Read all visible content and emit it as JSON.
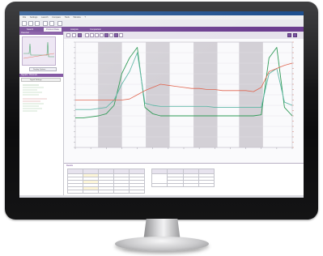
{
  "colors": {
    "bezel": "#111112",
    "title_bar": "#1e4f8e",
    "accent_purple": "#6b3d8f",
    "grey_band": "#d3d0d6",
    "green_trace": "#2f9a56",
    "teal_trace": "#5fb7a6",
    "red_trace": "#e0654f"
  },
  "window": {
    "title": ""
  },
  "menu": {
    "items": [
      "File",
      "Settings",
      "Launch",
      "Compare",
      "Tools",
      "Window",
      "?"
    ]
  },
  "tabs": [
    {
      "label": "Search"
    },
    {
      "label": "Protocol Data"
    },
    {
      "label": "Analysis"
    },
    {
      "label": "Comparison"
    }
  ],
  "left_panel": {
    "thumbnail_head": "Overview",
    "thumbnail_button": "Display Options",
    "tree_head": "Signals / Channels",
    "tree_toolbar_label": "Signal Settings"
  },
  "table": {
    "title": "Results",
    "headers": [
      "",
      "",
      "",
      "",
      "",
      ""
    ],
    "rows": 6
  },
  "chart_data": {
    "type": "line",
    "series": [
      {
        "values": [
          0.72,
          0.72,
          0.71,
          0.7,
          0.68,
          0.6,
          0.3,
          0.15,
          0.05,
          0.62,
          0.68,
          0.7,
          0.7,
          0.7,
          0.7,
          0.7,
          0.7,
          0.7,
          0.7,
          0.7,
          0.7,
          0.7,
          0.7,
          0.7,
          0.69,
          0.15,
          0.05,
          0.62,
          0.7
        ]
      },
      {
        "values": [
          0.64,
          0.64,
          0.64,
          0.63,
          0.62,
          0.55,
          0.4,
          0.28,
          0.1,
          0.58,
          0.6,
          0.61,
          0.61,
          0.61,
          0.61,
          0.61,
          0.61,
          0.61,
          0.62,
          0.62,
          0.62,
          0.62,
          0.62,
          0.62,
          0.62,
          0.3,
          0.25,
          0.57,
          0.6
        ]
      },
      {
        "values": [
          0.55,
          0.55,
          0.55,
          0.55,
          0.55,
          0.55,
          0.55,
          0.54,
          0.5,
          0.46,
          0.43,
          0.4,
          0.41,
          0.42,
          0.43,
          0.44,
          0.44,
          0.45,
          0.45,
          0.46,
          0.46,
          0.46,
          0.46,
          0.47,
          0.43,
          0.28,
          0.25,
          0.22,
          0.2
        ]
      }
    ],
    "grid": true,
    "legend": "none"
  }
}
